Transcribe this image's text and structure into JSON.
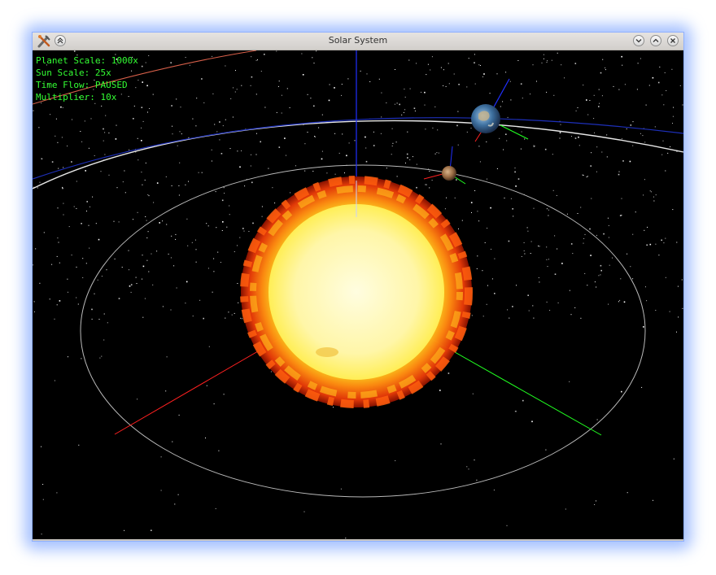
{
  "window": {
    "title": "Solar System"
  },
  "hud": {
    "planet_scale": "Planet Scale: 1000x",
    "sun_scale": "Sun Scale: 25x",
    "time_flow": "Time Flow: PAUSED",
    "multiplier": "Multiplier: 10x"
  },
  "colors": {
    "hud_text": "#33ff33",
    "background": "#000000",
    "x_axis": "#ff2020",
    "y_axis": "#20ff20",
    "z_axis": "#2030ff",
    "orbit": "#ffffff",
    "window_glow": "#5a8cff"
  },
  "icons": {
    "app": "tools-icon",
    "shade": "shade-up-icon",
    "minimize": "chevron-down-icon",
    "maximize": "chevron-up-icon",
    "close": "close-icon"
  }
}
